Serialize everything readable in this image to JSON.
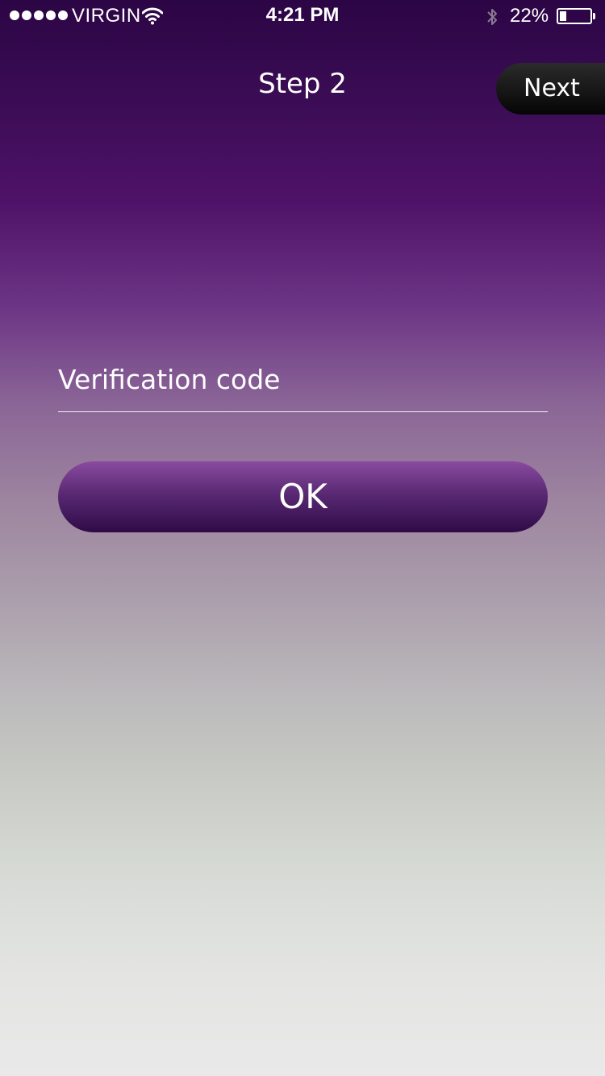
{
  "status_bar": {
    "carrier": "VIRGIN",
    "time": "4:21 PM",
    "battery_percent": "22%",
    "battery_level": 0.22,
    "icons": [
      "signal-dots-icon",
      "wifi-icon",
      "bluetooth-icon",
      "battery-icon"
    ]
  },
  "nav": {
    "title": "Step 2",
    "next_label": "Next"
  },
  "form": {
    "verification_code_placeholder": "Verification code",
    "verification_code_value": "",
    "ok_label": "OK"
  },
  "colors": {
    "background_top": "#2c0545",
    "background_bottom": "#e9e9e9",
    "ok_button": "#5a2a74",
    "next_button": "#111111"
  }
}
